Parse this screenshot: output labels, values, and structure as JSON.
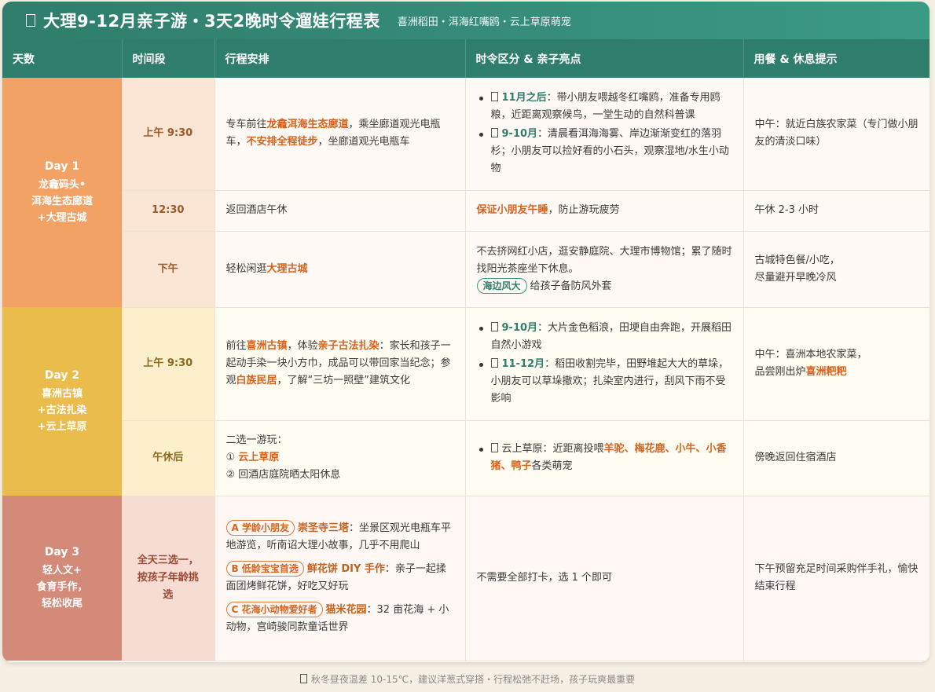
{
  "title": {
    "main": "大理9-12月亲子游・3天2晚时令遛娃行程表",
    "subtitle": "喜洲稻田・洱海红嘴鸥・云上草原萌宠"
  },
  "headers": [
    "天数",
    "时间段",
    "行程安排",
    "时令区分 & 亲子亮点",
    "用餐 & 休息提示"
  ],
  "day1": {
    "label": "Day 1",
    "desc": [
      "龙龕码头•",
      "洱海生态廊道",
      "+大理古城"
    ],
    "rows": [
      {
        "time": "上午 9:30",
        "plan": [
          "专车前往",
          "龙龕洱海生态廊道",
          "，乘坐廊道观光电瓶车，",
          "不安排全程徒步",
          "，坐廊道观光电瓶车"
        ],
        "points": [
          {
            "season": "11月之后",
            "text": "：带小朋友喂越冬红嘴鸥，准备专用鸥粮，近距离观察候鸟，一堂生动的自然科普课"
          },
          {
            "season": "9-10月",
            "text": "：清晨看洱海海雾、岸边渐渐变红的落羽杉；小朋友可以捡好看的小石头，观察湿地/水生小动物"
          }
        ],
        "meal": "中午：就近白族农家菜（专门做小朋友的清淡口味）"
      },
      {
        "time": "12:30",
        "plan": "返回酒店午休",
        "point_hl": "保证小朋友午睡",
        "point_rest": "，防止游玩疲劳",
        "meal": "午休 2-3 小时"
      },
      {
        "time": "下午",
        "plan_pre": "轻松闲逛",
        "plan_hl": "大理古城",
        "point": "不去挤网红小店，逛安静庭院、大理市博物馆；累了随时找阳光茶座坐下休息。",
        "badge": "海边风大",
        "badge_text": "给孩子备防风外套",
        "meal": [
          "古城特色餐/小吃，",
          "尽量避开早晚冷风"
        ]
      }
    ]
  },
  "day2": {
    "label": "Day 2",
    "desc": [
      "喜洲古镇",
      "+古法扎染",
      "+云上草原"
    ],
    "rows": [
      {
        "time": "上午 9:30",
        "plan": [
          "前往",
          "喜洲古镇",
          "，体验",
          "亲子古法扎染",
          "：家长和孩子一起动手染一块小方巾，成品可以带回家当纪念；参观",
          "白族民居",
          "，了解“三坊一照壁”建筑文化"
        ],
        "points": [
          {
            "season": "9-10月",
            "text": "：大片金色稻浪，田埂自由奔跑，开展稻田自然小游戏"
          },
          {
            "season": "11-12月",
            "text": "：稻田收割完毕，田野堆起大大的草垛，小朋友可以草垛撒欢；扎染室内进行，刮风下雨不受影响"
          }
        ],
        "meal_pre": "中午：喜洲本地农家菜，",
        "meal_line2": "品尝刚出炉",
        "meal_hl": "喜洲粑粑"
      },
      {
        "time": "午休后",
        "plan_intro": "二选一游玩：",
        "opt1_num": "①",
        "opt1": "云上草原",
        "opt2": "② 回酒店庭院晒太阳休息",
        "point_pre": "云上草原：近距离投喂",
        "point_hl": "羊驼、梅花鹿、小牛、小香猪、鸭子",
        "point_post": "各类萌宠",
        "meal": "傍晚返回住宿酒店"
      }
    ]
  },
  "day3": {
    "label": "Day 3",
    "desc": [
      "轻人文+",
      "食育手作，",
      "轻松收尾"
    ],
    "time": [
      "全天三选一，",
      "按孩子年龄挑",
      "选"
    ],
    "options": [
      {
        "tag": "A 学龄小朋友",
        "title": "崇圣寺三塔",
        "text": "：坐景区观光电瓶车平地游览，听南诏大理小故事，几乎不用爬山"
      },
      {
        "tag": "B 低龄宝宝首选",
        "title": "鲜花饼 DIY 手作",
        "text": "：亲子一起揉面团烤鲜花饼，好吃又好玩"
      },
      {
        "tag": "C 花海小动物爱好者",
        "title": "猫米花园",
        "text": "：32 亩花海 + 小动物，宫崎骏同款童话世界"
      }
    ],
    "point": "不需要全部打卡，选 1 个即可",
    "meal": "下午预留充足时间采购伴手礼，愉快结束行程"
  },
  "footer": "秋冬昼夜温差 10-15℃，建议洋葱式穿搭・行程松弛不赶场，孩子玩爽最重要",
  "colors": {
    "header_green": "#2f7d6b",
    "day1": "#f2a265",
    "day2": "#e9bc4c",
    "day3": "#d48a78",
    "highlight": "#d8621c"
  }
}
